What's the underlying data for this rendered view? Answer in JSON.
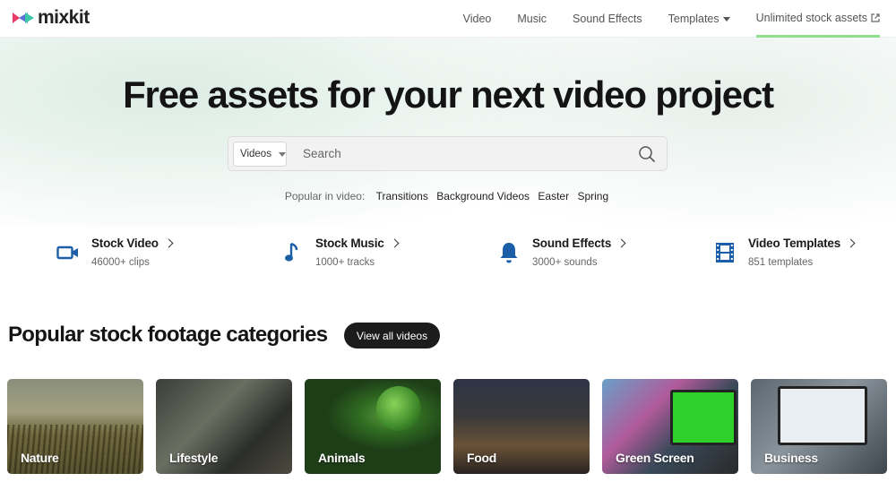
{
  "header": {
    "logo_text": "mixkit",
    "nav": [
      {
        "label": "Video"
      },
      {
        "label": "Music"
      },
      {
        "label": "Sound Effects"
      },
      {
        "label": "Templates"
      },
      {
        "label": "Unlimited stock assets"
      }
    ]
  },
  "hero": {
    "title": "Free assets for your next video project",
    "search": {
      "type_selected": "Videos",
      "placeholder": "Search"
    },
    "popular": {
      "label": "Popular in video:",
      "tags": [
        "Transitions",
        "Background Videos",
        "Easter",
        "Spring"
      ]
    }
  },
  "categories": [
    {
      "title": "Stock Video",
      "subtitle": "46000+ clips",
      "icon": "video-camera-icon"
    },
    {
      "title": "Stock Music",
      "subtitle": "1000+ tracks",
      "icon": "music-note-icon"
    },
    {
      "title": "Sound Effects",
      "subtitle": "3000+ sounds",
      "icon": "bell-icon"
    },
    {
      "title": "Video Templates",
      "subtitle": "851 templates",
      "icon": "film-strip-icon"
    }
  ],
  "footage": {
    "title": "Popular stock footage categories",
    "view_all_label": "View all videos",
    "items": [
      {
        "label": "Nature"
      },
      {
        "label": "Lifestyle"
      },
      {
        "label": "Animals"
      },
      {
        "label": "Food"
      },
      {
        "label": "Green Screen"
      },
      {
        "label": "Business"
      }
    ]
  },
  "colors": {
    "accent_blue": "#1c5fa8",
    "nav_active_underline": "#8ee08a",
    "button_dark": "#1c1c1c"
  }
}
